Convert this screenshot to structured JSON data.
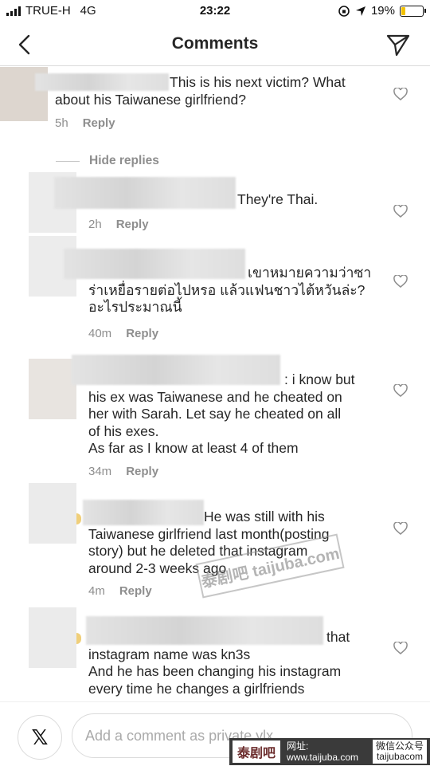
{
  "status_bar": {
    "carrier": "TRUE-H",
    "network": "4G",
    "time": "23:22",
    "battery": "19%"
  },
  "header": {
    "title": "Comments"
  },
  "hide_replies": "Hide replies",
  "comments": [
    {
      "text": "This is his next victim? What\nabout his Taiwanese girlfriend?",
      "time": "5h",
      "reply": "Reply"
    },
    {
      "text": "They're Thai.",
      "time": "2h",
      "reply": "Reply"
    },
    {
      "text": "เขาหมายความว่าซา\nร่าเหยื่อรายต่อไปหรอ แล้วแฟนชาวไต้หวันล่ะ?\nอะไรประมาณนี้",
      "time": "40m",
      "reply": "Reply"
    },
    {
      "text": ": i know but\nhis ex was Taiwanese and he cheated on\nher with Sarah. Let say he cheated on all\nof his exes.\nAs far as I know at least 4 of them",
      "time": "34m",
      "reply": "Reply"
    },
    {
      "text": "He was still with his\nTaiwanese girlfriend last month(posting\nstory) but he deleted that instagram\naround 2-3 weeks ago",
      "time": "4m",
      "reply": "Reply"
    },
    {
      "text": "that\ninstagram name was kn3s\nAnd he has been changing his instagram\nevery time he changes a girlfriends",
      "time": "",
      "reply": ""
    }
  ],
  "composer": {
    "placeholder": "Add a comment as private.ylx..."
  },
  "watermark": {
    "logo": "泰剧吧",
    "site_label": "网址:",
    "site": "www.taijuba.com",
    "wechat_label": "微信公众号",
    "wechat": "taijubacom"
  },
  "colors": {
    "meta_gray": "#8e8e8e",
    "text": "#262626",
    "battery_yellow": "#f2c200"
  }
}
